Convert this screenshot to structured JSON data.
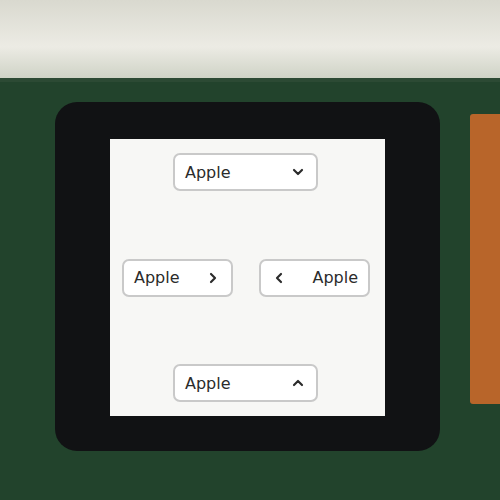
{
  "screen": {
    "dropdowns": [
      {
        "label": "Apple",
        "kind": "down"
      },
      {
        "label": "Apple",
        "kind": "right"
      },
      {
        "label": "Apple",
        "kind": "left"
      },
      {
        "label": "Apple",
        "kind": "up"
      }
    ]
  }
}
